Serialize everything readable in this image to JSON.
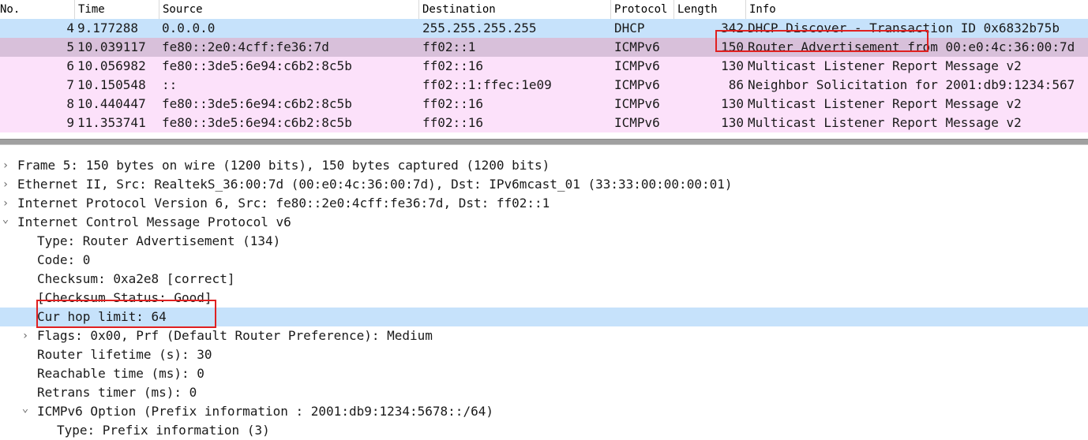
{
  "columns": [
    "No.",
    "Time",
    "Source",
    "Destination",
    "Protocol",
    "Length",
    "Info"
  ],
  "colors": {
    "selected_row": "#c6e2fb",
    "udp_row": "#dceaff",
    "icmpv6_row": "#fce1fa",
    "icmpv6_selected_row": "#d8c0da",
    "annotation": "#e02020"
  },
  "packets": [
    {
      "no": "4",
      "time": "9.177288",
      "source": "0.0.0.0",
      "destination": "255.255.255.255",
      "protocol": "DHCP",
      "length": "342",
      "info": "DHCP Discover - Transaction ID 0x6832b75b"
    },
    {
      "no": "5",
      "time": "10.039117",
      "source": "fe80::2e0:4cff:fe36:7d",
      "destination": "ff02::1",
      "protocol": "ICMPv6",
      "length": "150",
      "info": "Router Advertisement from 00:e0:4c:36:00:7d"
    },
    {
      "no": "6",
      "time": "10.056982",
      "source": "fe80::3de5:6e94:c6b2:8c5b",
      "destination": "ff02::16",
      "protocol": "ICMPv6",
      "length": "130",
      "info": "Multicast Listener Report Message v2"
    },
    {
      "no": "7",
      "time": "10.150548",
      "source": "::",
      "destination": "ff02::1:ffec:1e09",
      "protocol": "ICMPv6",
      "length": "86",
      "info": "Neighbor Solicitation for 2001:db9:1234:567"
    },
    {
      "no": "8",
      "time": "10.440447",
      "source": "fe80::3de5:6e94:c6b2:8c5b",
      "destination": "ff02::16",
      "protocol": "ICMPv6",
      "length": "130",
      "info": "Multicast Listener Report Message v2"
    },
    {
      "no": "9",
      "time": "11.353741",
      "source": "fe80::3de5:6e94:c6b2:8c5b",
      "destination": "ff02::16",
      "protocol": "ICMPv6",
      "length": "130",
      "info": "Multicast Listener Report Message v2"
    }
  ],
  "tree": [
    {
      "text": "Frame 5: 150 bytes on wire (1200 bits), 150 bytes captured (1200 bits)",
      "expander": "collapsed"
    },
    {
      "text": "Ethernet II, Src: RealtekS_36:00:7d (00:e0:4c:36:00:7d), Dst: IPv6mcast_01 (33:33:00:00:00:01)",
      "expander": "collapsed"
    },
    {
      "text": "Internet Protocol Version 6, Src: fe80::2e0:4cff:fe36:7d, Dst: ff02::1",
      "expander": "collapsed"
    },
    {
      "text": "Internet Control Message Protocol v6",
      "expander": "expanded"
    },
    {
      "text": "Type: Router Advertisement (134)",
      "expander": "none"
    },
    {
      "text": "Code: 0",
      "expander": "none"
    },
    {
      "text": "Checksum: 0xa2e8 [correct]",
      "expander": "none"
    },
    {
      "text": "[Checksum Status: Good]",
      "expander": "none"
    },
    {
      "text": "Cur hop limit: 64",
      "expander": "none",
      "selected": true
    },
    {
      "text": "Flags: 0x00, Prf (Default Router Preference): Medium",
      "expander": "collapsed"
    },
    {
      "text": "Router lifetime (s): 30",
      "expander": "none"
    },
    {
      "text": "Reachable time (ms): 0",
      "expander": "none"
    },
    {
      "text": "Retrans timer (ms): 0",
      "expander": "none"
    },
    {
      "text": "ICMPv6 Option (Prefix information : 2001:db9:1234:5678::/64)",
      "expander": "expanded"
    },
    {
      "text": "Type: Prefix information (3)",
      "expander": "none"
    }
  ],
  "icons": {
    "collapsed": "chevron-right-icon",
    "expanded": "chevron-down-icon"
  }
}
